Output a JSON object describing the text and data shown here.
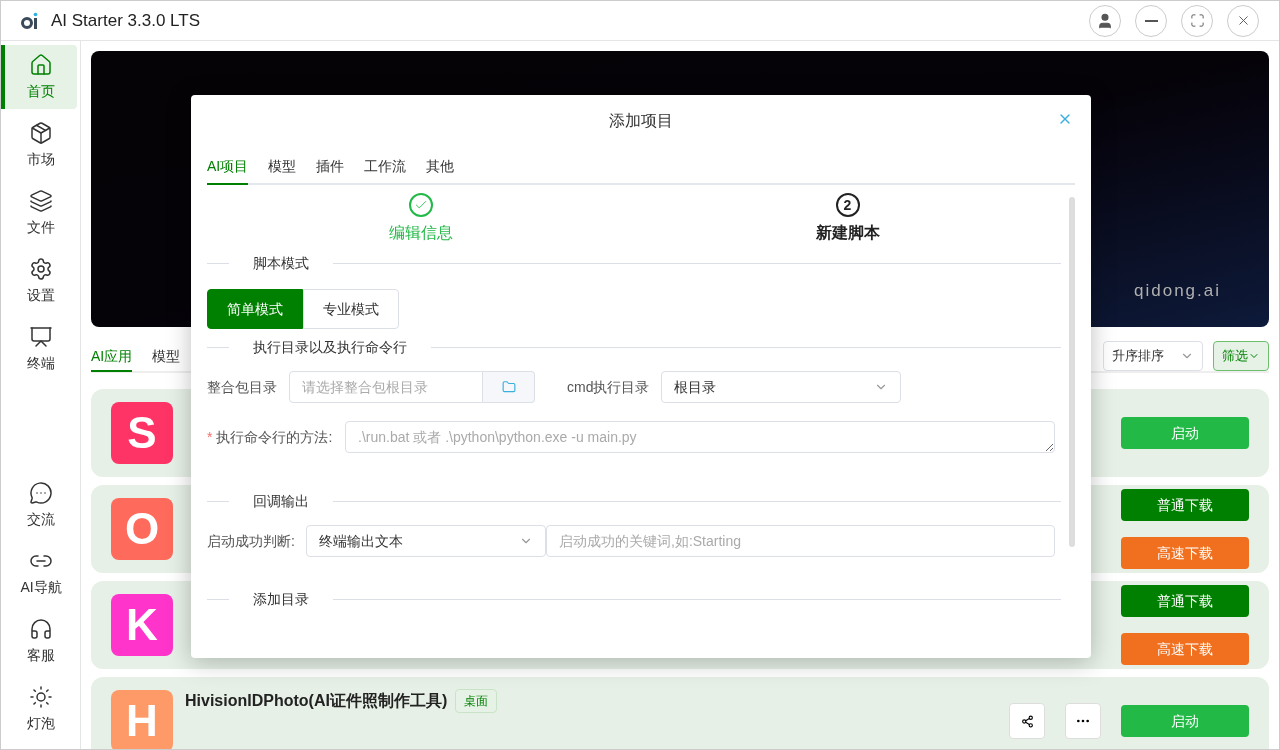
{
  "window": {
    "title": "AI Starter 3.3.0 LTS"
  },
  "sidebar": {
    "items": [
      {
        "label": "首页",
        "selected": true
      },
      {
        "label": "市场",
        "selected": false
      },
      {
        "label": "文件",
        "selected": false
      },
      {
        "label": "设置",
        "selected": false
      },
      {
        "label": "终端",
        "selected": false
      }
    ],
    "bottom_items": [
      {
        "label": "交流",
        "selected": false
      },
      {
        "label": "AI导航",
        "selected": false
      },
      {
        "label": "客服",
        "selected": false
      },
      {
        "label": "灯泡",
        "selected": false
      }
    ]
  },
  "banner": {
    "caption": "qidong.ai"
  },
  "tabs": [
    {
      "label": "AI应用",
      "selected": true
    },
    {
      "label": "模型",
      "selected": false
    }
  ],
  "sort": {
    "value": "升序排序"
  },
  "filter": {
    "label": "筛选"
  },
  "cards": [
    {
      "letter": "S",
      "color": "#fe3366",
      "actions": [
        {
          "label": "启动",
          "kind": "launch"
        }
      ]
    },
    {
      "letter": "O",
      "color": "#fe6a5c",
      "actions": [
        {
          "label": "普通下载",
          "kind": "download"
        },
        {
          "label": "高速下载",
          "kind": "fast"
        }
      ]
    },
    {
      "letter": "K",
      "color": "#fe34cb",
      "actions": [
        {
          "label": "普通下载",
          "kind": "download"
        },
        {
          "label": "高速下载",
          "kind": "fast"
        }
      ]
    },
    {
      "letter": "H",
      "color": "#fe9a68",
      "title": "HivisionIDPhoto(AI证件照制作工具)",
      "tag": "桌面",
      "actions": [
        {
          "label": "启动",
          "kind": "launch"
        }
      ],
      "share": true
    }
  ],
  "dialog": {
    "title": "添加项目",
    "tabs": [
      {
        "label": "AI项目",
        "selected": true
      },
      {
        "label": "模型",
        "selected": false
      },
      {
        "label": "插件",
        "selected": false
      },
      {
        "label": "工作流",
        "selected": false
      },
      {
        "label": "其他",
        "selected": false
      }
    ],
    "steps": [
      {
        "label": "编辑信息",
        "done": true
      },
      {
        "number": "2",
        "label": "新建脚本",
        "done": false
      }
    ],
    "sections": [
      "脚本模式",
      "执行目录以及执行命令行",
      "回调输出",
      "添加目录"
    ],
    "modes": [
      {
        "label": "简单模式",
        "selected": true
      },
      {
        "label": "专业模式",
        "selected": false
      }
    ],
    "package_dir": {
      "label": "整合包目录",
      "placeholder": "请选择整合包根目录"
    },
    "cmd_dir": {
      "label": "cmd执行目录",
      "value": "根目录"
    },
    "command": {
      "label": "执行命令行的方法:",
      "required_mark": "*",
      "placeholder": ".\\run.bat 或者 .\\python\\python.exe -u main.py"
    },
    "success_check": {
      "label": "启动成功判断:",
      "value": "终端输出文本",
      "placeholder": "启动成功的关键词,如:Starting"
    }
  }
}
